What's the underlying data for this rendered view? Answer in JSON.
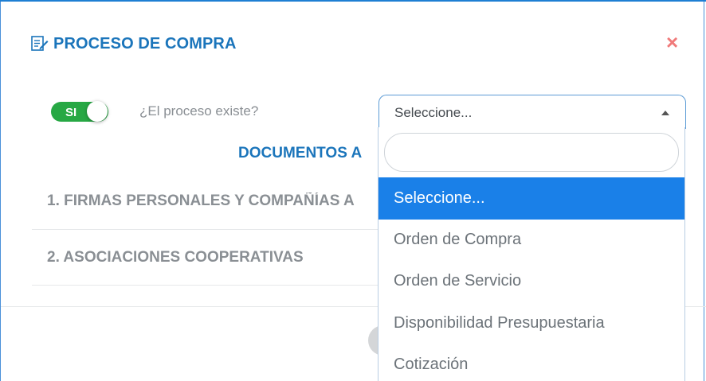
{
  "modal": {
    "title": "PROCESO DE COMPRA",
    "close_label": "×"
  },
  "toggle": {
    "state_label": "SI",
    "question": "¿El proceso existe?"
  },
  "select": {
    "value": "Seleccione..."
  },
  "documents": {
    "heading": "DOCUMENTOS A",
    "items": [
      "1. FIRMAS PERSONALES Y COMPAÑÍAS A",
      "2. ASOCIACIONES COOPERATIVAS"
    ]
  },
  "dropdown": {
    "search_value": "",
    "options": [
      "Seleccione...",
      "Orden de Compra",
      "Orden de Servicio",
      "Disponibilidad Presupuestaria",
      "Cotización"
    ],
    "selected_option": "Seleccione..."
  },
  "colors": {
    "accent": "#1b75bb",
    "selected_bg": "#1a80e8",
    "toggle_on": "#27a844",
    "close": "#f07a7a"
  },
  "icons": {
    "title_icon": "document-edit-icon",
    "close_icon": "close-icon",
    "caret": "caret-up-icon"
  }
}
